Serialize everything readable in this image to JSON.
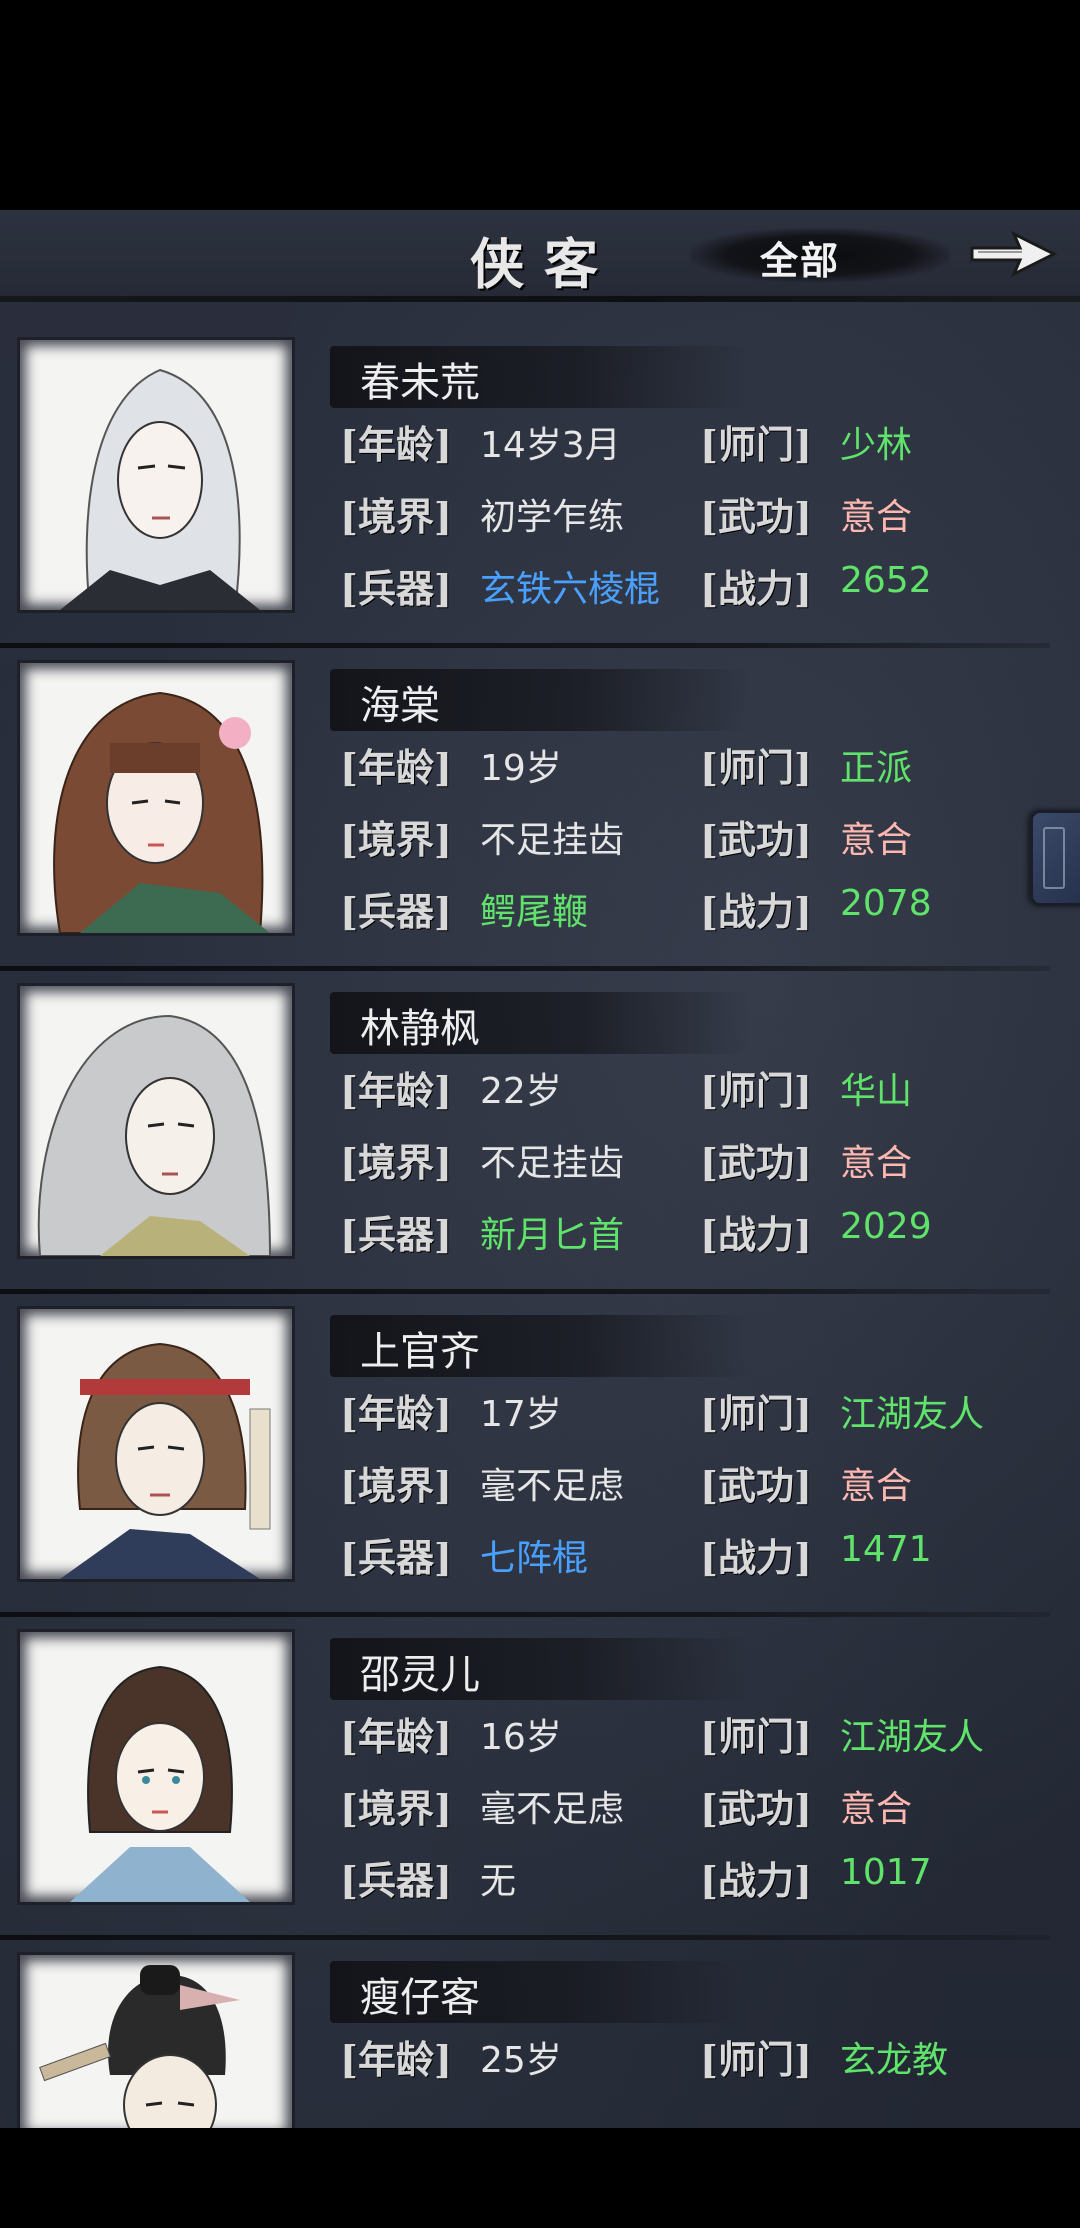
{
  "header": {
    "title": "侠客",
    "filter": "全部",
    "arrow_icon": "arrow-right-icon"
  },
  "labels": {
    "age": "[年龄]",
    "sect": "[师门]",
    "realm": "[境界]",
    "martial": "[武功]",
    "weapon": "[兵器]",
    "power": "[战力]"
  },
  "colors": {
    "green": "#5fe36a",
    "blue": "#4aa0ff",
    "pink": "#ffb8b0"
  },
  "heroes": [
    {
      "name": "春未荒",
      "age": "14岁3月",
      "sect": "少林",
      "realm": "初学乍练",
      "martial": "意合",
      "weapon": "玄铁六棱棍",
      "power": "2652"
    },
    {
      "name": "海棠",
      "age": "19岁",
      "sect": "正派",
      "realm": "不足挂齿",
      "martial": "意合",
      "weapon": "鳄尾鞭",
      "power": "2078"
    },
    {
      "name": "林静枫",
      "age": "22岁",
      "sect": "华山",
      "realm": "不足挂齿",
      "martial": "意合",
      "weapon": "新月匕首",
      "power": "2029"
    },
    {
      "name": "上官齐",
      "age": "17岁",
      "sect": "江湖友人",
      "realm": "毫不足虑",
      "martial": "意合",
      "weapon": "七阵棍",
      "power": "1471"
    },
    {
      "name": "邵灵儿",
      "age": "16岁",
      "sect": "江湖友人",
      "realm": "毫不足虑",
      "martial": "意合",
      "weapon": "无",
      "power": "1017"
    },
    {
      "name": "瘦仔客",
      "age": "25岁",
      "sect": "玄龙教",
      "realm": "",
      "martial": "",
      "weapon": "",
      "power": ""
    }
  ]
}
